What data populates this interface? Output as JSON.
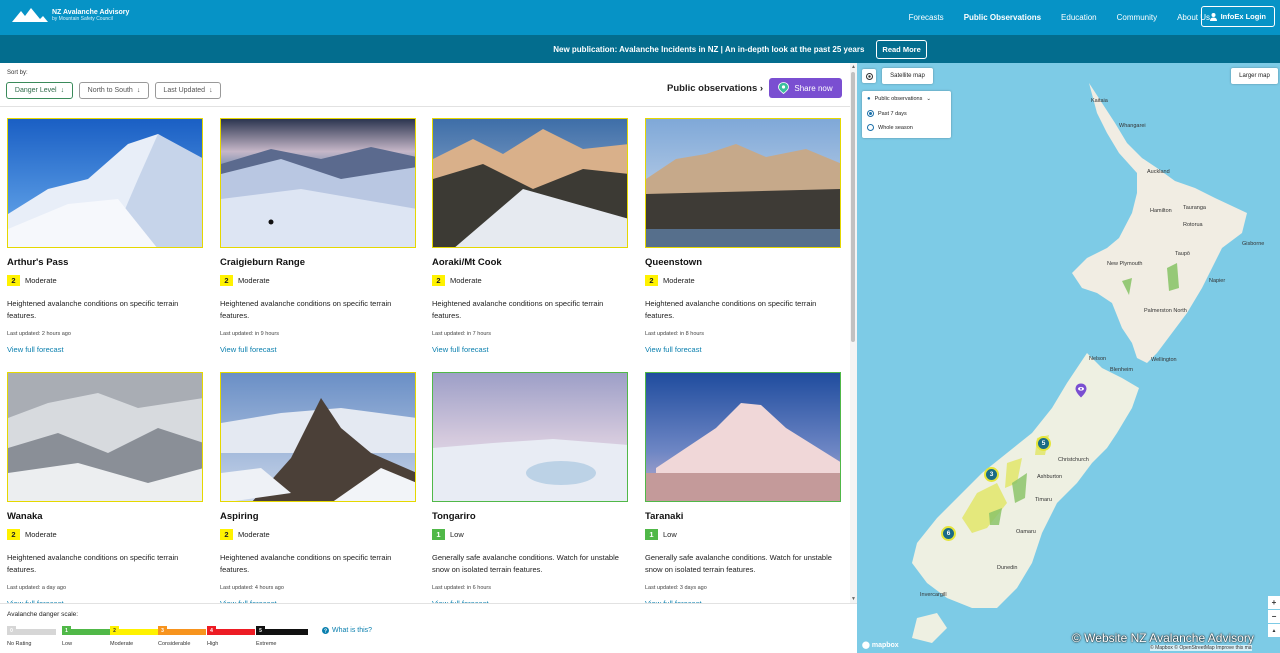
{
  "header": {
    "logo_title": "NZ Avalanche Advisory",
    "logo_subtitle": "by Mountain Safety Council",
    "nav": [
      "Forecasts",
      "Public Observations",
      "Education",
      "Community",
      "About Us"
    ],
    "active_nav": "Public Observations",
    "login_label": "InfoEx Login"
  },
  "announcement": {
    "text": "New publication: Avalanche Incidents in NZ | An in-depth look at the past 25 years",
    "button": "Read More"
  },
  "sort": {
    "label": "Sort by:",
    "options": [
      "Danger Level",
      "North to South",
      "Last Updated"
    ],
    "active": "Danger Level"
  },
  "public_obs": {
    "heading": "Public observations",
    "chevron": "›",
    "share_label": "Share now"
  },
  "cards": [
    {
      "title": "Arthur's Pass",
      "level": "2",
      "level_label": "Moderate",
      "desc": "Heightened avalanche conditions on specific terrain features.",
      "updated": "Last updated: 2 hours ago",
      "link": "View full forecast"
    },
    {
      "title": "Craigieburn Range",
      "level": "2",
      "level_label": "Moderate",
      "desc": "Heightened avalanche conditions on specific terrain features.",
      "updated": "Last updated: in 9 hours",
      "link": "View full forecast"
    },
    {
      "title": "Aoraki/Mt Cook",
      "level": "2",
      "level_label": "Moderate",
      "desc": "Heightened avalanche conditions on specific terrain features.",
      "updated": "Last updated: in 7 hours",
      "link": "View full forecast"
    },
    {
      "title": "Queenstown",
      "level": "2",
      "level_label": "Moderate",
      "desc": "Heightened avalanche conditions on specific terrain features.",
      "updated": "Last updated: in 8 hours",
      "link": "View full forecast"
    },
    {
      "title": "Wanaka",
      "level": "2",
      "level_label": "Moderate",
      "desc": "Heightened avalanche conditions on specific terrain features.",
      "updated": "Last updated: a day ago",
      "link": "View full forecast"
    },
    {
      "title": "Aspiring",
      "level": "2",
      "level_label": "Moderate",
      "desc": "Heightened avalanche conditions on specific terrain features.",
      "updated": "Last updated: 4 hours ago",
      "link": "View full forecast"
    },
    {
      "title": "Tongariro",
      "level": "1",
      "level_label": "Low",
      "desc": "Generally safe avalanche conditions. Watch for unstable snow on isolated terrain features.",
      "updated": "Last updated: in 6 hours",
      "link": "View full forecast"
    },
    {
      "title": "Taranaki",
      "level": "1",
      "level_label": "Low",
      "desc": "Generally safe avalanche conditions. Watch for unstable snow on isolated terrain features.",
      "updated": "Last updated: 3 days ago",
      "link": "View full forecast"
    }
  ],
  "scale": {
    "title": "Avalanche danger scale:",
    "levels": [
      {
        "num": "0",
        "label": "No Rating",
        "color": "#d6d6d6"
      },
      {
        "num": "1",
        "label": "Low",
        "color": "#50b848"
      },
      {
        "num": "2",
        "label": "Moderate",
        "color": "#fff200"
      },
      {
        "num": "3",
        "label": "Considerable",
        "color": "#f7941e"
      },
      {
        "num": "4",
        "label": "High",
        "color": "#ed1c24"
      },
      {
        "num": "5",
        "label": "Extreme",
        "color": "#111111"
      }
    ],
    "help": "What is this?"
  },
  "map": {
    "satellite_label": "Satellite map",
    "larger_label": "Larger map",
    "layer_title": "Public observations",
    "layer_options": [
      "Past 7 days",
      "Whole season"
    ],
    "layer_selected": "Past 7 days",
    "places": [
      "Kaitaia",
      "Whangarei",
      "Auckland",
      "Hamilton",
      "Tauranga",
      "Rotorua",
      "Taupō",
      "Gisborne",
      "New Plymouth",
      "Napier",
      "Palmerston North",
      "Nelson",
      "Blenheim",
      "Wellington",
      "Christchurch",
      "Ashburton",
      "Timaru",
      "Oamaru",
      "Dunedin",
      "Invercargill"
    ],
    "clusters": [
      "5",
      "3",
      "6"
    ],
    "zoom_in": "+",
    "zoom_out": "−",
    "compass": "▲",
    "watermark": "© Website NZ Avalanche Advisory",
    "attribution": "© Mapbox © OpenStreetMap  Improve this ma",
    "mapbox_logo": "mapbox"
  },
  "colors": {
    "nav_bg": "#0693c6",
    "announce_bg": "#036d8e",
    "share_bg": "#7a4fd1",
    "moderate": "#fff200",
    "low": "#50b848",
    "link": "#0a7fae"
  }
}
